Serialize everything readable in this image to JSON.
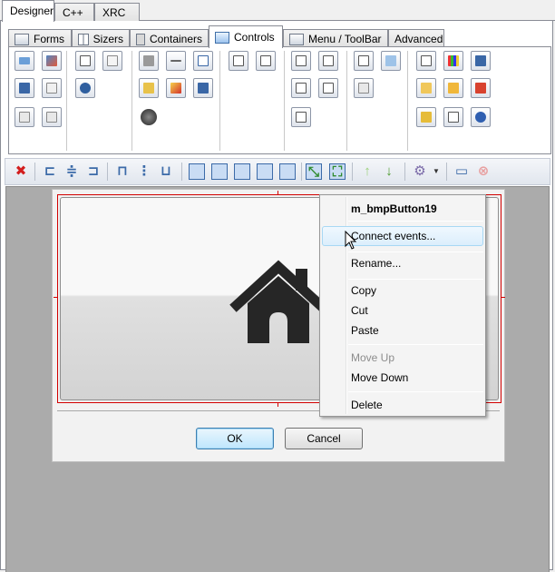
{
  "outer_tabs": [
    "Designer",
    "C++",
    "XRC"
  ],
  "inner_tabs": [
    "Forms",
    "Sizers",
    "Containers",
    "Controls",
    "Menu / ToolBar",
    "Advanced"
  ],
  "active_inner_tab": "Controls",
  "dialog": {
    "ok_label": "OK",
    "cancel_label": "Cancel"
  },
  "context_menu": {
    "title": "m_bmpButton19",
    "items": [
      "Connect events...",
      "Rename...",
      "Copy",
      "Cut",
      "Paste",
      "Move Up",
      "Move Down",
      "Delete"
    ]
  },
  "colors": {
    "selection_border": "#d20000",
    "highlight": "#a8d8f4",
    "canvas": "#ababab"
  }
}
